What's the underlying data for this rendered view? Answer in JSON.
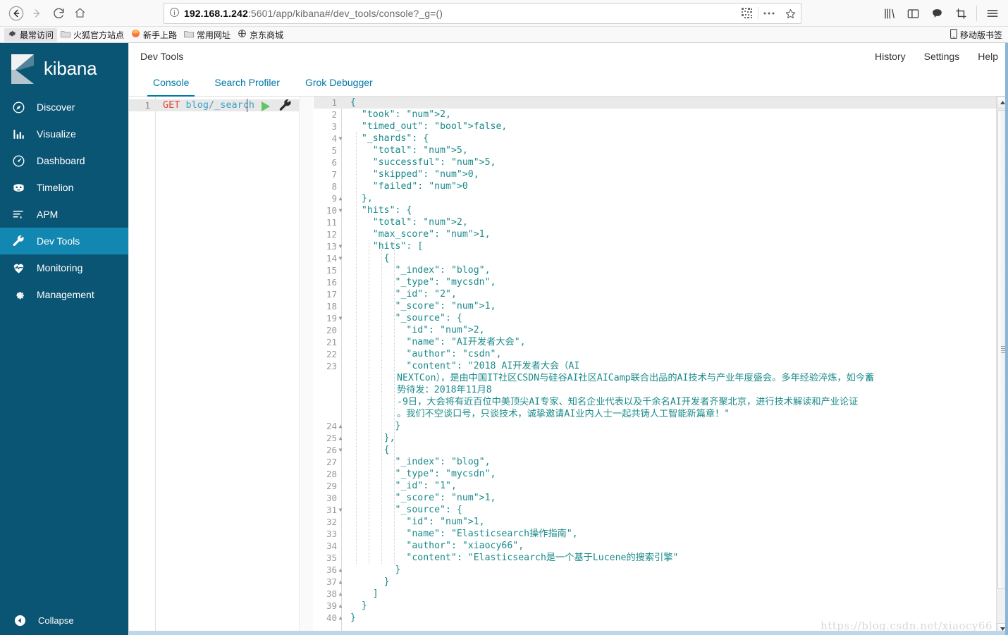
{
  "browser": {
    "back_icon": "back-arrow-icon",
    "forward_icon": "forward-arrow-icon",
    "reload_icon": "reload-icon",
    "home_icon": "home-icon",
    "url_host": "192.168.1.242",
    "url_rest": ":5601/app/kibana#/dev_tools/console?_g=()",
    "info_icon": "page-info-icon",
    "qr_icon": "qr-code-icon",
    "more_icon": "more-actions-icon",
    "star_icon": "bookmark-star-icon",
    "library_icon": "library-icon",
    "sidebar_icon": "sidebar-icon",
    "pocket_icon": "pocket-icon",
    "screenshot_icon": "screenshot-icon",
    "menu_icon": "hamburger-menu-icon"
  },
  "bookmarks": {
    "items": [
      {
        "label": "最常访问",
        "icon": "gear-icon"
      },
      {
        "label": "火狐官方站点",
        "icon": "folder-icon"
      },
      {
        "label": "新手上路",
        "icon": "firefox-icon"
      },
      {
        "label": "常用网址",
        "icon": "folder-icon"
      },
      {
        "label": "京东商城",
        "icon": "globe-icon"
      }
    ],
    "mobile_label": "移动版书签",
    "mobile_icon": "mobile-icon"
  },
  "sidebar": {
    "brand": "kibana",
    "items": [
      {
        "label": "Discover",
        "icon": "compass-icon",
        "active": false
      },
      {
        "label": "Visualize",
        "icon": "bar-chart-icon",
        "active": false
      },
      {
        "label": "Dashboard",
        "icon": "dashboard-icon",
        "active": false
      },
      {
        "label": "Timelion",
        "icon": "timelion-icon",
        "active": false
      },
      {
        "label": "APM",
        "icon": "apm-icon",
        "active": false
      },
      {
        "label": "Dev Tools",
        "icon": "wrench-icon",
        "active": true
      },
      {
        "label": "Monitoring",
        "icon": "heartbeat-icon",
        "active": false
      },
      {
        "label": "Management",
        "icon": "gear-icon",
        "active": false
      }
    ],
    "collapse_label": "Collapse",
    "collapse_icon": "collapse-left-icon",
    "active_color": "#1287b1",
    "bg_color": "#0b5574"
  },
  "header": {
    "title": "Dev Tools",
    "links": [
      "History",
      "Settings",
      "Help"
    ]
  },
  "tabs": [
    {
      "label": "Console",
      "active": true
    },
    {
      "label": "Search Profiler",
      "active": false
    },
    {
      "label": "Grok Debugger",
      "active": false
    }
  ],
  "editor": {
    "line_number": "1",
    "method": "GET",
    "path": "blog/_search",
    "play_icon": "run-request-icon",
    "wrench_icon": "wrench-icon"
  },
  "output": {
    "lines": [
      {
        "n": "1",
        "fold": "",
        "text": "{"
      },
      {
        "n": "2",
        "fold": "",
        "text": "  \"took\": 2,"
      },
      {
        "n": "3",
        "fold": "",
        "text": "  \"timed_out\": false,"
      },
      {
        "n": "4",
        "fold": "v",
        "text": "  \"_shards\": {"
      },
      {
        "n": "5",
        "fold": "",
        "text": "    \"total\": 5,"
      },
      {
        "n": "6",
        "fold": "",
        "text": "    \"successful\": 5,"
      },
      {
        "n": "7",
        "fold": "",
        "text": "    \"skipped\": 0,"
      },
      {
        "n": "8",
        "fold": "",
        "text": "    \"failed\": 0"
      },
      {
        "n": "9",
        "fold": "^",
        "text": "  },"
      },
      {
        "n": "10",
        "fold": "v",
        "text": "  \"hits\": {"
      },
      {
        "n": "11",
        "fold": "",
        "text": "    \"total\": 2,"
      },
      {
        "n": "12",
        "fold": "",
        "text": "    \"max_score\": 1,"
      },
      {
        "n": "13",
        "fold": "v",
        "text": "    \"hits\": ["
      },
      {
        "n": "14",
        "fold": "v",
        "text": "      {"
      },
      {
        "n": "15",
        "fold": "",
        "text": "        \"_index\": \"blog\","
      },
      {
        "n": "16",
        "fold": "",
        "text": "        \"_type\": \"mycsdn\","
      },
      {
        "n": "17",
        "fold": "",
        "text": "        \"_id\": \"2\","
      },
      {
        "n": "18",
        "fold": "",
        "text": "        \"_score\": 1,"
      },
      {
        "n": "19",
        "fold": "v",
        "text": "        \"_source\": {"
      },
      {
        "n": "20",
        "fold": "",
        "text": "          \"id\": 2,"
      },
      {
        "n": "21",
        "fold": "",
        "text": "          \"name\": \"AI开发者大会\","
      },
      {
        "n": "22",
        "fold": "",
        "text": "          \"author\": \"csdn\","
      },
      {
        "n": "23",
        "fold": "",
        "text": "          \"content\": \"2018 AI开发者大会（AI"
      }
    ],
    "wrapped_content": [
      "NEXTCon），是由中国IT社区CSDN与硅谷AI社区AICamp联合出品的AI技术与产业年度盛会。多年经验淬炼，如今蓄",
      "势待发：2018年11月8",
      "-9日，大会将有近百位中美顶尖AI专家、知名企业代表以及千余名AI开发者齐聚北京，进行技术解读和产业论证",
      "。我们不空谈口号，只谈技术，诚挚邀请AI业内人士一起共铸人工智能新篇章！\""
    ],
    "lines2": [
      {
        "n": "24",
        "fold": "^",
        "text": "        }"
      },
      {
        "n": "25",
        "fold": "^",
        "text": "      },"
      },
      {
        "n": "26",
        "fold": "v",
        "text": "      {"
      },
      {
        "n": "27",
        "fold": "",
        "text": "        \"_index\": \"blog\","
      },
      {
        "n": "28",
        "fold": "",
        "text": "        \"_type\": \"mycsdn\","
      },
      {
        "n": "29",
        "fold": "",
        "text": "        \"_id\": \"1\","
      },
      {
        "n": "30",
        "fold": "",
        "text": "        \"_score\": 1,"
      },
      {
        "n": "31",
        "fold": "v",
        "text": "        \"_source\": {"
      },
      {
        "n": "32",
        "fold": "",
        "text": "          \"id\": 1,"
      },
      {
        "n": "33",
        "fold": "",
        "text": "          \"name\": \"Elasticsearch操作指南\","
      },
      {
        "n": "34",
        "fold": "",
        "text": "          \"author\": \"xiaocy66\","
      },
      {
        "n": "35",
        "fold": "",
        "text": "          \"content\": \"Elasticsearch是一个基于Lucene的搜索引擎\""
      },
      {
        "n": "36",
        "fold": "^",
        "text": "        }"
      },
      {
        "n": "37",
        "fold": "^",
        "text": "      }"
      },
      {
        "n": "38",
        "fold": "^",
        "text": "    ]"
      },
      {
        "n": "39",
        "fold": "^",
        "text": "  }"
      },
      {
        "n": "40",
        "fold": "^",
        "text": "}"
      }
    ],
    "scrollbar": {
      "up_icon": "scroll-up-icon",
      "down_icon": "scroll-down-icon"
    }
  },
  "watermark": "https://blog.csdn.net/xiaocy66"
}
